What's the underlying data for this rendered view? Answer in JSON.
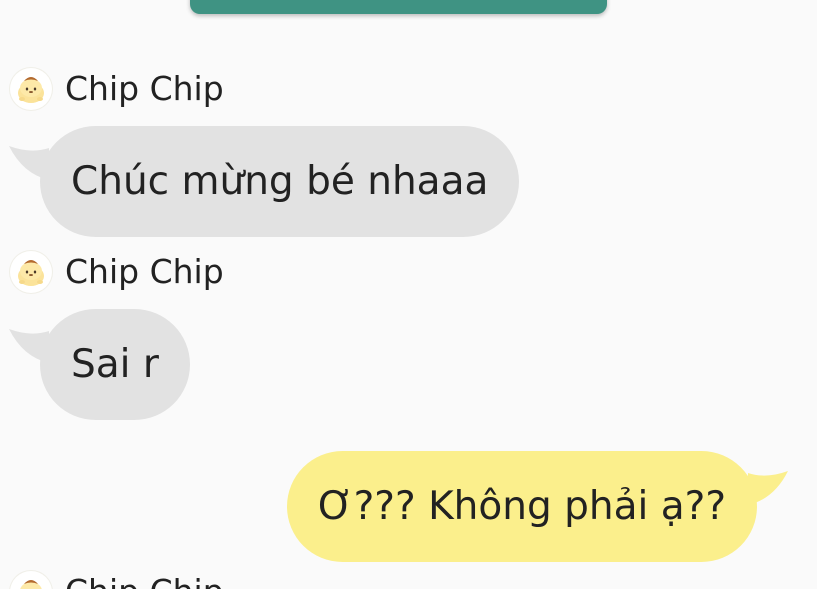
{
  "header": {
    "accent_color": "#3f9383"
  },
  "messages": [
    {
      "type": "incoming",
      "sender": "Chip Chip",
      "avatar_icon": "pompompurin-avatar-icon",
      "text": "Chúc mừng bé nhaaa"
    },
    {
      "type": "incoming",
      "sender": "Chip Chip",
      "avatar_icon": "pompompurin-avatar-icon",
      "text": "Sai r"
    },
    {
      "type": "outgoing",
      "text": "Ơ??? Không phải ạ??"
    },
    {
      "type": "incoming",
      "sender": "Chip Chip",
      "avatar_icon": "pompompurin-avatar-icon"
    }
  ],
  "colors": {
    "background": "#fafafa",
    "incoming_bubble": "#e2e2e2",
    "outgoing_bubble": "#fbef8c",
    "text": "#222222"
  }
}
